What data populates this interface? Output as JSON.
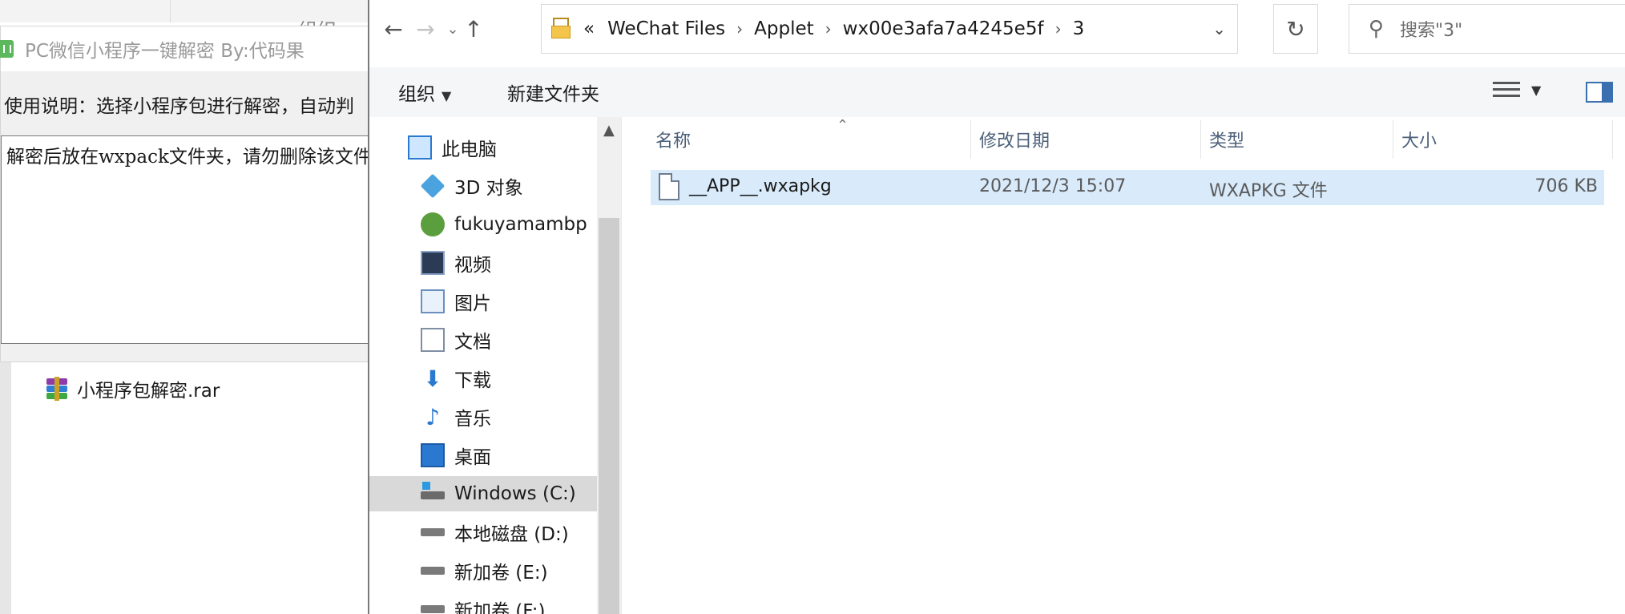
{
  "background_window": {
    "header_partial": "组织",
    "file_name": "小程序包解密.rar"
  },
  "tool_window": {
    "title": "PC微信小程序一键解密 By:代码果",
    "instructions": "使用说明：选择小程序包进行解密，自动判",
    "output_text": "解密后放在wxpack文件夹，请勿删除该文件"
  },
  "explorer": {
    "breadcrumb": [
      "«",
      "WeChat Files",
      "Applet",
      "wx00e3afa7a4245e5f",
      "3"
    ],
    "search_placeholder": "搜索\"3\"",
    "toolbar": {
      "organize": "组织",
      "new_folder": "新建文件夹"
    },
    "nav_items": [
      {
        "label": "此电脑",
        "icon": "computer-icon"
      },
      {
        "label": "3D 对象",
        "icon": "3d-objects-icon"
      },
      {
        "label": "fukuyamambp",
        "icon": "network-computer-icon"
      },
      {
        "label": "视频",
        "icon": "videos-icon"
      },
      {
        "label": "图片",
        "icon": "pictures-icon"
      },
      {
        "label": "文档",
        "icon": "documents-icon"
      },
      {
        "label": "下载",
        "icon": "downloads-icon"
      },
      {
        "label": "音乐",
        "icon": "music-icon"
      },
      {
        "label": "桌面",
        "icon": "desktop-icon"
      },
      {
        "label": "Windows (C:)",
        "icon": "windows-drive-icon"
      },
      {
        "label": "本地磁盘 (D:)",
        "icon": "drive-icon"
      },
      {
        "label": "新加卷 (E:)",
        "icon": "drive-icon"
      },
      {
        "label": "新加卷 (F:)",
        "icon": "drive-icon"
      }
    ],
    "columns": {
      "name": "名称",
      "modified": "修改日期",
      "type": "类型",
      "size": "大小"
    },
    "files": [
      {
        "name": "__APP__.wxapkg",
        "modified": "2021/12/3 15:07",
        "type": "WXAPKG 文件",
        "size": "706 KB"
      }
    ],
    "selection_color": "#d9ebfb"
  }
}
